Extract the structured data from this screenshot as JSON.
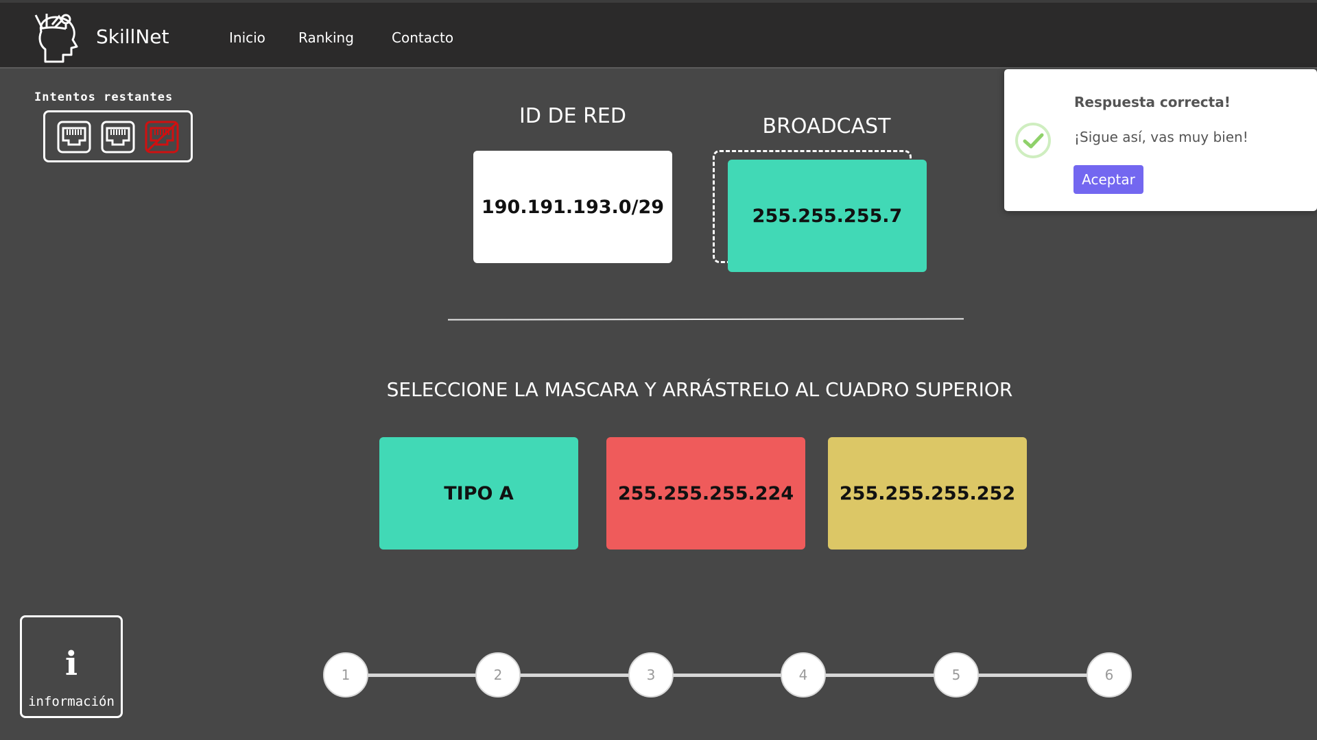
{
  "navbar": {
    "brand": "SkillNet",
    "links": [
      "Inicio",
      "Ranking",
      "Contacto"
    ]
  },
  "attempts": {
    "label": "Intentos restantes",
    "total": 3,
    "remaining": 2
  },
  "targets": {
    "network_id": {
      "title": "ID DE RED",
      "value": "190.191.193.0/29"
    },
    "broadcast": {
      "title": "BROADCAST",
      "value": "255.255.255.7"
    }
  },
  "instruction": "SELECCIONE LA MASCARA Y ARRÁSTRELO AL CUADRO SUPERIOR",
  "options": [
    {
      "value": "TIPO A",
      "color": "#41d9b6"
    },
    {
      "value": "255.255.255.224",
      "color": "#ef5b5b"
    },
    {
      "value": "255.255.255.252",
      "color": "#dcc766"
    }
  ],
  "info_button": {
    "icon": "i",
    "label": "información"
  },
  "stepper": {
    "steps": [
      "1",
      "2",
      "3",
      "4",
      "5",
      "6"
    ]
  },
  "toast": {
    "title": "Respuesta correcta!",
    "message": "¡Sigue así, vas muy bien!",
    "button_label": "Aceptar",
    "icon": "success-check-icon"
  },
  "colors": {
    "background": "#474747",
    "navbar": "#2b2a2a",
    "teal": "#41d9b6",
    "red": "#ef5b5b",
    "yellow": "#dcc766",
    "toast_button": "#7367f0",
    "toast_success": "#a5dc86"
  }
}
